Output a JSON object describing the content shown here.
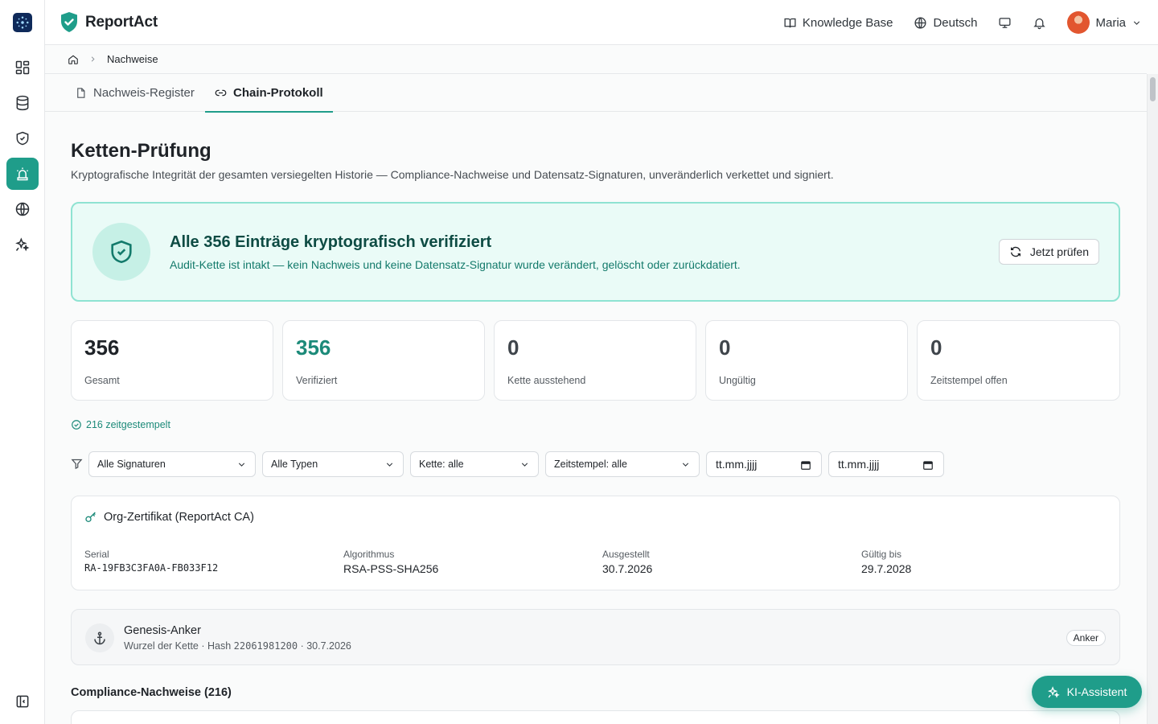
{
  "app": {
    "name": "ReportAct"
  },
  "header": {
    "knowledge_base": "Knowledge Base",
    "language": "Deutsch",
    "user_name": "Maria"
  },
  "breadcrumb": {
    "current": "Nachweise"
  },
  "tabs": [
    {
      "label": "Nachweis-Register",
      "active": false
    },
    {
      "label": "Chain-Protokoll",
      "active": true
    }
  ],
  "page": {
    "title": "Ketten-Prüfung",
    "subtitle": "Kryptografische Integrität der gesamten versiegelten Historie — Compliance-Nachweise und Datensatz-Signaturen, unveränderlich verkettet und signiert."
  },
  "verification": {
    "title": "Alle 356 Einträge kryptografisch verifiziert",
    "subtitle": "Audit-Kette ist intakt — kein Nachweis und keine Datensatz-Signatur wurde verändert, gelöscht oder zurückdatiert.",
    "button": "Jetzt prüfen"
  },
  "stats": [
    {
      "value": "356",
      "label": "Gesamt",
      "style": "default"
    },
    {
      "value": "356",
      "label": "Verifiziert",
      "style": "teal"
    },
    {
      "value": "0",
      "label": "Kette ausstehend",
      "style": "muted"
    },
    {
      "value": "0",
      "label": "Ungültig",
      "style": "muted"
    },
    {
      "value": "0",
      "label": "Zeitstempel offen",
      "style": "muted"
    }
  ],
  "timestamped": "216 zeitgestempelt",
  "filters": {
    "signatures": "Alle Signaturen",
    "types": "Alle Typen",
    "chain": "Kette: alle",
    "timestamp": "Zeitstempel: alle",
    "date_from": "tt.mm.jjjj",
    "date_to": "tt.mm.jjjj"
  },
  "certificate": {
    "title": "Org-Zertifikat (ReportAct CA)",
    "fields": [
      {
        "key": "Serial",
        "value": "RA-19FB3C3FA0A-FB033F12"
      },
      {
        "key": "Algorithmus",
        "value": "RSA-PSS-SHA256"
      },
      {
        "key": "Ausgestellt",
        "value": "30.7.2026"
      },
      {
        "key": "Gültig bis",
        "value": "29.7.2028"
      }
    ]
  },
  "genesis": {
    "title": "Genesis-Anker",
    "sub_prefix": "Wurzel der Kette · Hash ",
    "hash": "22061981200",
    "sub_suffix": " · 30.7.2026",
    "badge": "Anker"
  },
  "compliance_section": "Compliance-Nachweise (216)",
  "assistant": "KI-Assistent",
  "colors": {
    "accent": "#1f9d8a",
    "success_bg": "#eafbf7",
    "success_border": "#8fe3d2"
  }
}
